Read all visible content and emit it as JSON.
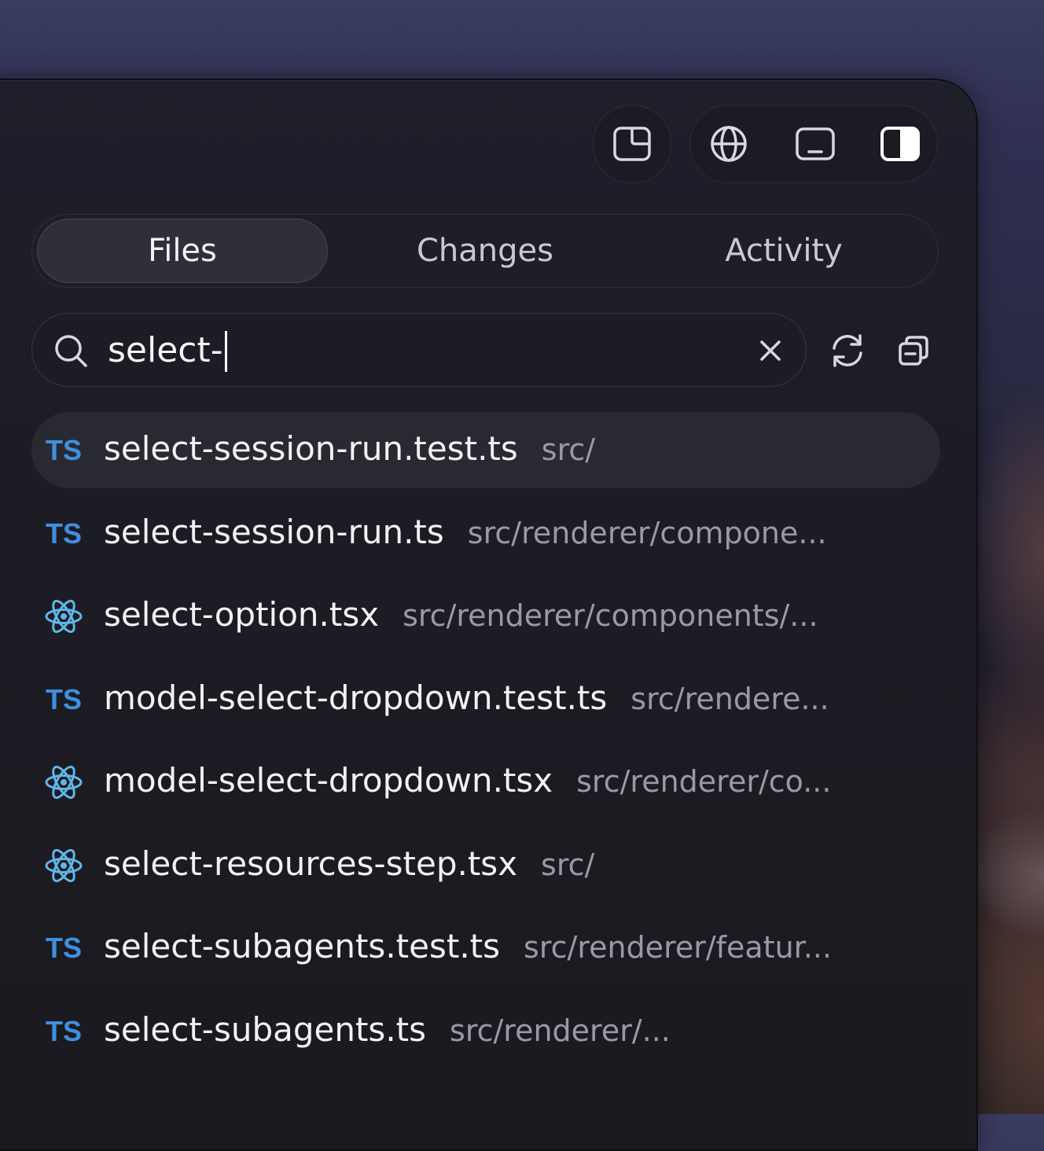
{
  "toolbar": {
    "buttons": [
      {
        "icon": "panel-layout-icon"
      },
      {
        "icon": "globe-icon"
      },
      {
        "icon": "terminal-panel-icon"
      },
      {
        "icon": "sidebar-toggle-icon"
      }
    ]
  },
  "tabs": [
    {
      "label": "Files",
      "active": true
    },
    {
      "label": "Changes",
      "active": false
    },
    {
      "label": "Activity",
      "active": false
    }
  ],
  "search": {
    "value": "select-",
    "placeholder": ""
  },
  "results": [
    {
      "type": "ts",
      "badge": "TS",
      "name": "select-session-run.test.ts",
      "path": "src/",
      "selected": true
    },
    {
      "type": "ts",
      "badge": "TS",
      "name": "select-session-run.ts",
      "path": "src/renderer/compone...",
      "selected": false
    },
    {
      "type": "react",
      "badge": "",
      "name": "select-option.tsx",
      "path": "src/renderer/components/...",
      "selected": false
    },
    {
      "type": "ts",
      "badge": "TS",
      "name": "model-select-dropdown.test.ts",
      "path": "src/rendere...",
      "selected": false
    },
    {
      "type": "react",
      "badge": "",
      "name": "model-select-dropdown.tsx",
      "path": "src/renderer/co...",
      "selected": false
    },
    {
      "type": "react",
      "badge": "",
      "name": "select-resources-step.tsx",
      "path": "src/",
      "selected": false
    },
    {
      "type": "ts",
      "badge": "TS",
      "name": "select-subagents.test.ts",
      "path": "src/renderer/featur...",
      "selected": false
    },
    {
      "type": "ts",
      "badge": "TS",
      "name": "select-subagents.ts",
      "path": "src/renderer/...",
      "selected": false
    }
  ],
  "colors": {
    "ts_accent": "#3f8fe0",
    "react_accent": "#5fb6e8",
    "text_primary": "#f2f2f4",
    "text_secondary": "#9a9aa6"
  }
}
